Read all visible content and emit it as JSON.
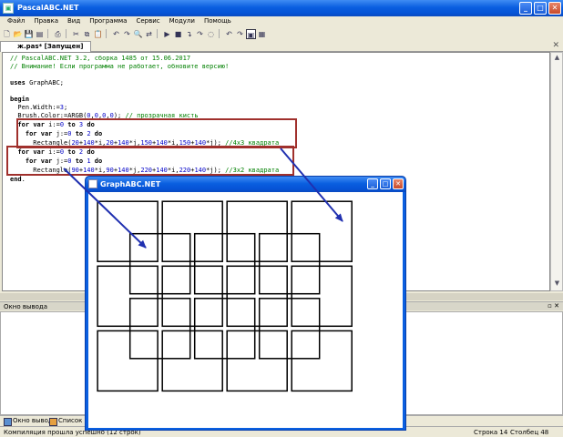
{
  "window": {
    "title": "PascalABC.NET",
    "min_label": "_",
    "max_label": "□",
    "close_label": "✕"
  },
  "menu": {
    "items": [
      "Файл",
      "Правка",
      "Вид",
      "Программа",
      "Сервис",
      "Модули",
      "Помощь"
    ]
  },
  "editor_tab": {
    "label": "ж.pas* [Запущен]",
    "close_label": "✕"
  },
  "code": {
    "lines": [
      {
        "type": "comment",
        "text": "// PascalABC.NET 3.2, сборка 1485 от 15.06.2017"
      },
      {
        "type": "comment",
        "text": "// Внимание! Если программа не работает, обновите версию!"
      },
      {
        "type": "blank",
        "text": ""
      },
      {
        "type": "code",
        "text": "uses GraphABC;"
      },
      {
        "type": "blank",
        "text": ""
      },
      {
        "type": "code",
        "text": "begin"
      },
      {
        "type": "code",
        "text": "  Pen.Width:=3;"
      },
      {
        "type": "code",
        "text": "  Brush.Color:=ARGB(0,0,0,0); // прозрачная кисть"
      },
      {
        "type": "code",
        "text": "  for var i:=0 to 3 do"
      },
      {
        "type": "code",
        "text": "    for var j:=0 to 2 do"
      },
      {
        "type": "code",
        "text": "      Rectangle(20+140*i,20+140*j,150+140*i,150+140*j); //4x3 квадрата"
      },
      {
        "type": "code",
        "text": "  for var i:=0 to 2 do"
      },
      {
        "type": "code",
        "text": "    for var j:=0 to 1 do"
      },
      {
        "type": "code",
        "text": "      Rectangle(90+140*i,90+140*j,220+140*i,220+140*j); //3x2 квадрата"
      },
      {
        "type": "code",
        "text": "end."
      }
    ]
  },
  "output_panel": {
    "title": "Окно вывода",
    "pin_label": "▫",
    "close_label": "✕"
  },
  "bottom_tabs": {
    "output": "Окно вывода",
    "errors": "Список ош"
  },
  "status": {
    "message": "Компиляция прошла успешно (12 строк)",
    "line_label": "Строка  14",
    "col_label": "Столбец  48"
  },
  "graph_window": {
    "title": "GraphABC.NET",
    "min_label": "_",
    "max_label": "□",
    "close_label": "✕",
    "grid_a": {
      "cols": 4,
      "rows": 3,
      "offset": 20,
      "step": 140,
      "size": 130
    },
    "grid_b": {
      "cols": 3,
      "rows": 2,
      "offset": 90,
      "step": 140,
      "size": 130
    },
    "canvas_units": {
      "width": 680,
      "height": 510
    },
    "pen_width": 3
  },
  "colors": {
    "highlight_box": "#a0302c",
    "arrow": "#2030b0",
    "comment": "#008000"
  }
}
